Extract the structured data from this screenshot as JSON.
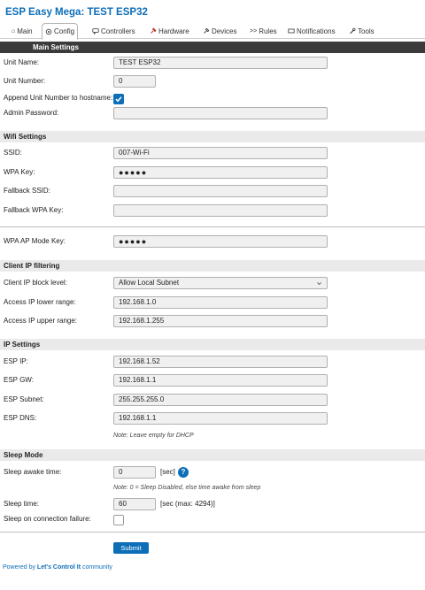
{
  "title": "ESP Easy Mega: TEST ESP32",
  "tabs": [
    {
      "label": "Main",
      "icon": "home-icon"
    },
    {
      "label": "Config",
      "icon": "gear-icon"
    },
    {
      "label": "Controllers",
      "icon": "chat-icon"
    },
    {
      "label": "Hardware",
      "icon": "pin-icon"
    },
    {
      "label": "Devices",
      "icon": "plug-icon"
    },
    {
      "label": "Rules",
      "icon": "arrow-icon"
    },
    {
      "label": "Notifications",
      "icon": "envelope-icon"
    },
    {
      "label": "Tools",
      "icon": "wrench-icon"
    }
  ],
  "active_tab": "Config",
  "sections": {
    "main": "Main Settings",
    "wifi": "Wifi Settings",
    "client_ip": "Client IP filtering",
    "ip": "IP Settings",
    "sleep": "Sleep Mode"
  },
  "main": {
    "unit_name_label": "Unit Name:",
    "unit_name": "TEST ESP32",
    "unit_number_label": "Unit Number:",
    "unit_number": "0",
    "append_label": "Append Unit Number to hostname:",
    "append_checked": true,
    "admin_pw_label": "Admin Password:",
    "admin_pw": ""
  },
  "wifi": {
    "ssid_label": "SSID:",
    "ssid": "007-Wi-Fi",
    "wpa_key_label": "WPA Key:",
    "wpa_key": "●●●●●",
    "fallback_ssid_label": "Fallback SSID:",
    "fallback_ssid": "",
    "fallback_wpa_label": "Fallback WPA Key:",
    "fallback_wpa": "",
    "ap_key_label": "WPA AP Mode Key:",
    "ap_key": "●●●●●"
  },
  "client_ip": {
    "block_level_label": "Client IP block level:",
    "block_level": "Allow Local Subnet",
    "lower_label": "Access IP lower range:",
    "lower": "192.168.1.0",
    "upper_label": "Access IP upper range:",
    "upper": "192.168.1.255"
  },
  "ip": {
    "ip_label": "ESP IP:",
    "ip": "192.168.1.52",
    "gw_label": "ESP GW:",
    "gw": "192.168.1.1",
    "subnet_label": "ESP Subnet:",
    "subnet": "255.255.255.0",
    "dns_label": "ESP DNS:",
    "dns": "192.168.1.1",
    "note": "Note: Leave empty for DHCP"
  },
  "sleep": {
    "awake_label": "Sleep awake time:",
    "awake": "0",
    "awake_unit": "[sec]",
    "awake_note": "Note: 0 = Sleep Disabled, else time awake from sleep",
    "sleep_label": "Sleep time:",
    "sleep": "60",
    "sleep_unit": "[sec (max: 4294)]",
    "fail_label": "Sleep on connection failure:",
    "fail_checked": false,
    "help": "?"
  },
  "submit_label": "Submit",
  "footer": {
    "prefix": "Powered by ",
    "brand": "Let's Control It",
    "suffix": " community"
  },
  "colors": {
    "accent": "#0d6eb8",
    "dark_header": "#3b3b3b",
    "section_bg": "#eaeaea"
  }
}
